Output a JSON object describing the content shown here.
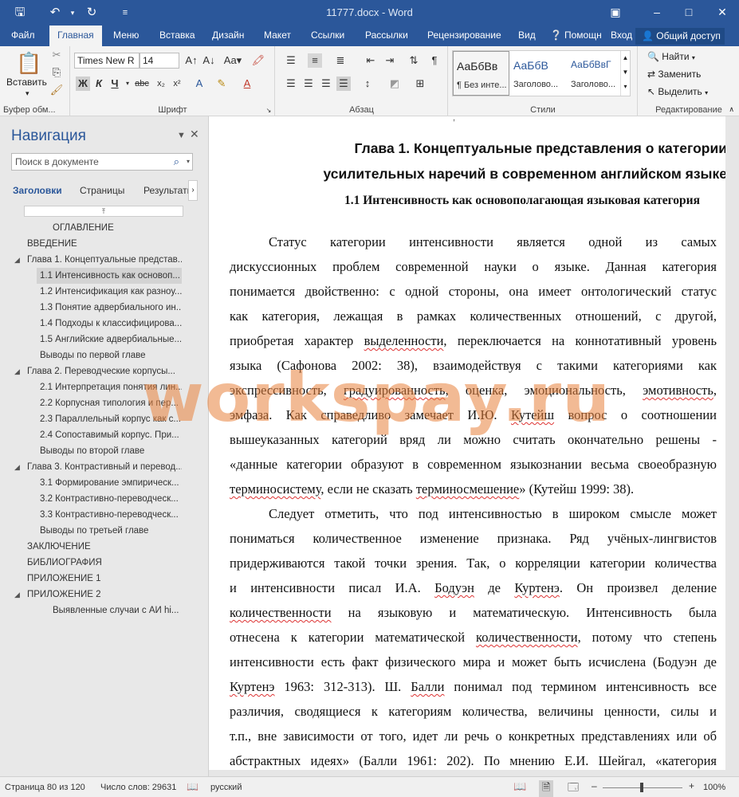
{
  "titlebar": {
    "title": "11777.docx - Word",
    "save_icon": "save-icon",
    "undo_icon": "undo-icon",
    "redo_icon": "redo-icon"
  },
  "tabs": {
    "file": "Файл",
    "home": "Главная",
    "menu": "Меню",
    "insert": "Вставка",
    "design": "Дизайн",
    "layout": "Макет",
    "references": "Ссылки",
    "mailings": "Рассылки",
    "review": "Рецензирование",
    "view": "Вид",
    "help": "Помощн",
    "signin": "Вход",
    "share": "Общий доступ"
  },
  "ribbon": {
    "paste_label": "Вставить",
    "clipboard_label": "Буфер обм...",
    "font_name": "Times New R",
    "font_size": "14",
    "font_label": "Шрифт",
    "paragraph_label": "Абзац",
    "styles_label": "Стили",
    "editing_label": "Редактирование",
    "styles": [
      {
        "sample": "АаБбВв",
        "name": "¶ Без инте..."
      },
      {
        "sample": "АаБбВ",
        "name": "Заголово..."
      },
      {
        "sample": "АаБбВвГ",
        "name": "Заголово..."
      }
    ],
    "find": "Найти",
    "replace": "Заменить",
    "select": "Выделить"
  },
  "nav": {
    "title": "Навигация",
    "search_placeholder": "Поиск в документе",
    "tab_headings": "Заголовки",
    "tab_pages": "Страницы",
    "tab_results": "Результаты",
    "items": [
      {
        "label": "ОГЛАВЛЕНИЕ"
      },
      {
        "label": "ВВЕДЕНИЕ"
      },
      {
        "label": "Глава 1. Концептуальные представ..."
      },
      {
        "label": "1.1 Интенсивность как основоп..."
      },
      {
        "label": "1.2 Интенсификация как разноу..."
      },
      {
        "label": "1.3 Понятие адвербиального ин..."
      },
      {
        "label": "1.4 Подходы к классифицирова..."
      },
      {
        "label": "1.5 Английские адвербиальные..."
      },
      {
        "label": "Выводы по первой главе"
      },
      {
        "label": "Глава 2. Переводческие корпусы..."
      },
      {
        "label": "2.1 Интерпретация понятия лин..."
      },
      {
        "label": "2.2 Корпусная типология и пер..."
      },
      {
        "label": "2.3 Параллельный корпус как с..."
      },
      {
        "label": "2.4 Сопоставимый корпус. При..."
      },
      {
        "label": "Выводы по второй главе"
      },
      {
        "label": "Глава 3. Контрастивный и перевод..."
      },
      {
        "label": "3.1 Формирование эмпирическ..."
      },
      {
        "label": "3.2 Контрастивно-переводческ..."
      },
      {
        "label": "3.3 Контрастивно-переводческ..."
      },
      {
        "label": "Выводы по третьей главе"
      },
      {
        "label": "ЗАКЛЮЧЕНИЕ"
      },
      {
        "label": "БИБЛИОГРАФИЯ"
      },
      {
        "label": "ПРИЛОЖЕНИЕ 1"
      },
      {
        "label": "ПРИЛОЖЕНИЕ 2"
      },
      {
        "label": "Выявленные случаи с АИ hi..."
      }
    ]
  },
  "doc": {
    "h1_line1": "Глава 1. Концептуальные представления о категории",
    "h1_line2": "усилительных наречий в современном английском языке",
    "h2": "1.1 Интенсивность как основополагающая языковая категория",
    "p1": [
      "Статус категории интенсивности является одной из самых",
      "дискуссионных проблем современной науки о языке. Данная категория",
      "понимается двойственно: с одной стороны, она имеет онтологический статус",
      "как категория, лежащая в рамках количественных отношений, с другой,",
      [
        "приобретая характер ",
        "выделенности",
        ", переключается на коннотативный уровень"
      ],
      "языка (Сафонова 2002: 38), взаимодействуя с такими категориями как",
      [
        "экспрессивность, ",
        "градуированность",
        ", оценка, эмоциональность, ",
        "эмотивность",
        ","
      ],
      [
        "эмфаза. Как справедливо замечает И.Ю. ",
        "Кутейш",
        " вопрос о соотношении"
      ],
      "вышеуказанных категорий вряд ли можно считать окончательно решены -",
      "«данные категории образуют в современном языкознании весьма своеобразную",
      [
        "",
        "терминосистему",
        ", если не сказать ",
        "терминосмешение",
        "» (Кутейш 1999: 38)."
      ]
    ],
    "p2": [
      "Следует отметить, что под интенсивностью в широком смысле может",
      "пониматься количественное изменение признака. Ряд учёных-лингвистов",
      "придерживаются такой точки зрения. Так, о корреляции категории количества",
      [
        "и интенсивности писал И.А. ",
        "Бодуэн",
        " де ",
        "Куртенэ",
        ". Он произвел деление"
      ],
      [
        "",
        "количественности",
        " на языковую и математическую. Интенсивность была"
      ],
      [
        "отнесена к категории математической ",
        "количественности",
        ", потому что степень"
      ],
      "интенсивности есть факт физического мира и может быть исчислена (Бодуэн де",
      [
        "",
        "Куртенэ",
        " 1963: 312-313). Ш. ",
        "Балли",
        " понимал под термином интенсивность все"
      ],
      "различия, сводящиеся к категориям количества, величины ценности, силы и",
      "т.п., вне зависимости от того, идет ли речь о конкретных представлениях или об",
      "абстрактных идеях» (Балли 1961: 202). По мнению Е.И. Шейгал, «категория"
    ]
  },
  "watermark": "workspay.ru",
  "status": {
    "page": "Страница 80 из 120",
    "words": "Число слов: 29631",
    "language": "русский",
    "zoom": "100%"
  }
}
